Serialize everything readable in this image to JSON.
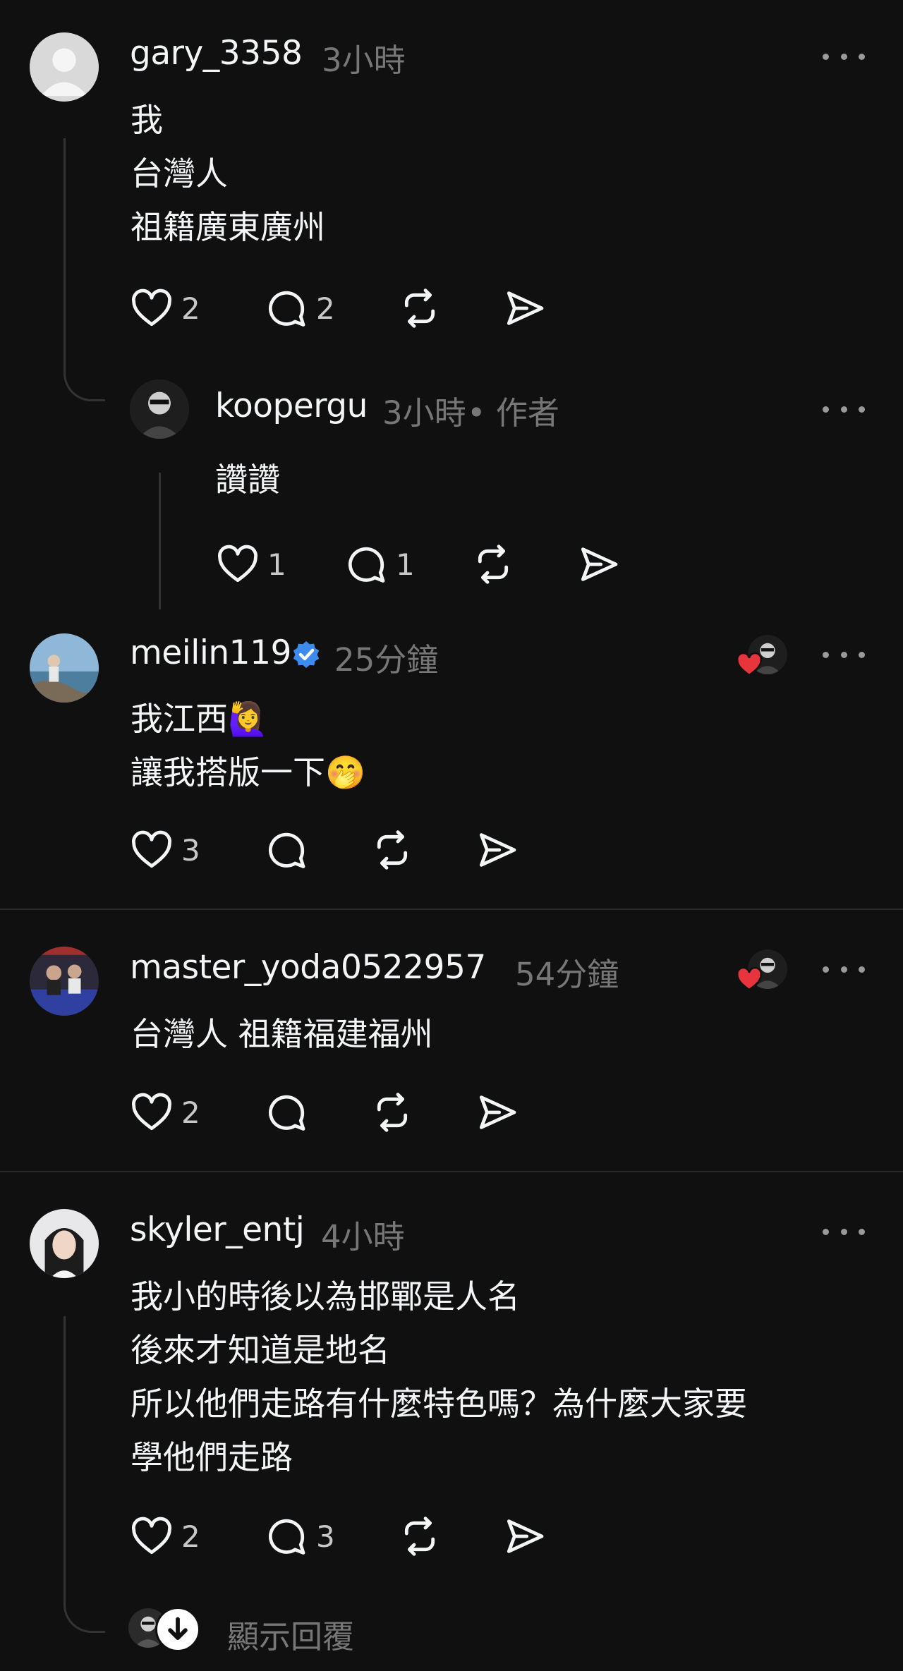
{
  "comments": [
    {
      "username": "gary_3358",
      "time": "3小時",
      "lines": [
        "我",
        "台灣人",
        "祖籍廣東廣州"
      ],
      "likes": "2",
      "replies": "2"
    },
    {
      "username": "koopergu",
      "time": "3小時",
      "author_tag": "• 作者",
      "lines": [
        "讚讚"
      ],
      "likes": "1",
      "replies": "1"
    },
    {
      "username": "meilin119",
      "verified": true,
      "time": "25分鐘",
      "lines": [
        "我江西🙋‍♀️",
        "讓我搭版一下🤭"
      ],
      "likes": "3",
      "replies": ""
    },
    {
      "username": "master_yoda0522957",
      "time": "54分鐘",
      "lines": [
        "台灣人 祖籍福建福州"
      ],
      "likes": "2",
      "replies": ""
    },
    {
      "username": "skyler_entj",
      "time": "4小時",
      "lines": [
        "我小的時後以為邯鄲是人名",
        "後來才知道是地名",
        "所以他們走路有什麼特色嗎？為什麼大家要",
        "學他們走路"
      ],
      "likes": "2",
      "replies": "3"
    }
  ],
  "show_replies_label": "顯示回覆",
  "colors": {
    "background": "#101010",
    "text": "#f3f5f7",
    "muted": "#777777",
    "verified": "#3c8cf0",
    "heart": "#e8343c"
  }
}
